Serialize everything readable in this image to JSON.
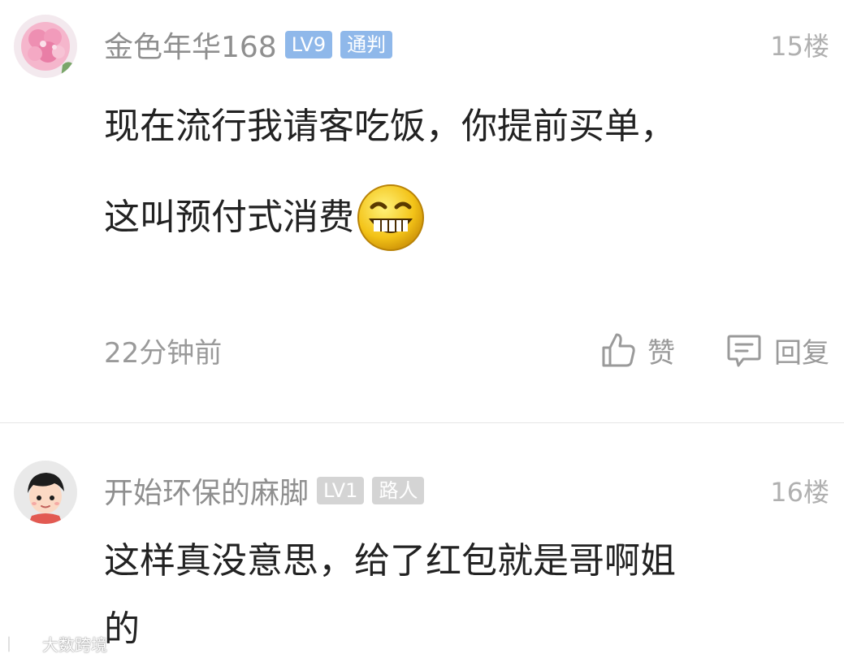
{
  "comments": [
    {
      "username": "金色年华168",
      "level": "LV9",
      "title": "通判",
      "floor": "15楼",
      "content_lines": [
        "现在流行我请客吃饭，你提前买单，",
        "这叫预付式消费"
      ],
      "emoji": "grinning-face",
      "time": "22分钟前",
      "like_label": "赞",
      "reply_label": "回复"
    },
    {
      "username": "开始环保的麻脚",
      "level": "LV1",
      "title": "路人",
      "floor": "16楼",
      "content_lines": [
        "这样真没意思，给了红包就是哥啊姐",
        "的"
      ]
    }
  ],
  "badge_colors": {
    "high_level": "#8fb8ea",
    "low_level": "#d4d4d4"
  },
  "watermark": {
    "text": "大数跨境"
  }
}
